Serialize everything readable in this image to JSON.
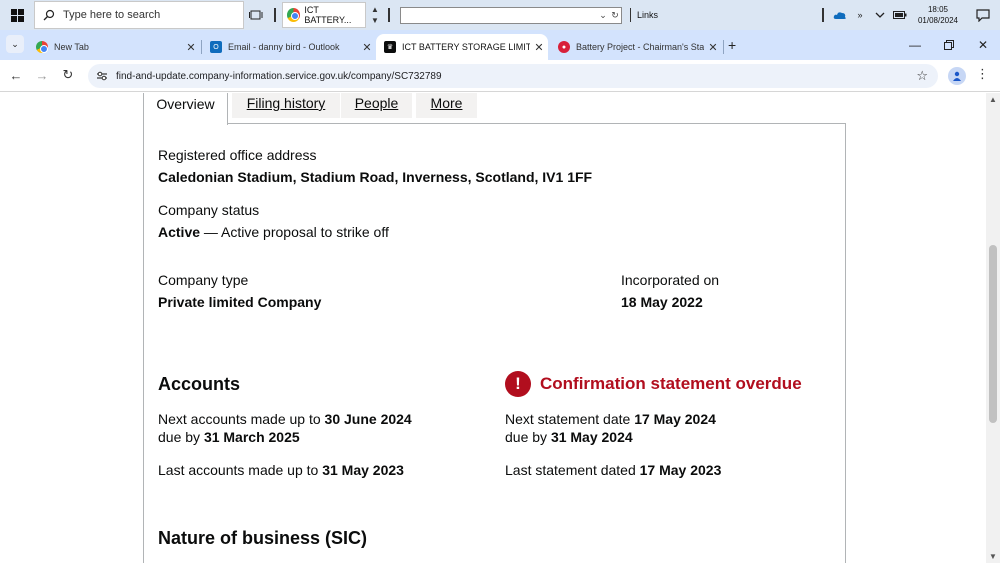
{
  "taskbar": {
    "search_placeholder": "Type here to search",
    "app_label": "ICT BATTERY...",
    "links_label": "Links",
    "clock_time": "18:05",
    "clock_date": "01/08/2024"
  },
  "browser": {
    "tabs": [
      {
        "label": "New Tab"
      },
      {
        "label": "Email - danny bird - Outlook"
      },
      {
        "label": "ICT BATTERY STORAGE LIMITED"
      },
      {
        "label": "Battery Project - Chairman's Sta"
      }
    ],
    "url": "find-and-update.company-information.service.gov.uk/company/SC732789"
  },
  "page": {
    "tabs": {
      "overview": "Overview",
      "filing_history": "Filing history",
      "people": "People",
      "more": "More"
    },
    "registered_office": {
      "label": "Registered office address",
      "value": "Caledonian Stadium, Stadium Road, Inverness, Scotland, IV1 1FF"
    },
    "company_status": {
      "label": "Company status",
      "value": "Active",
      "detail": " — Active proposal to strike off"
    },
    "company_type": {
      "label": "Company type",
      "value": "Private limited Company"
    },
    "incorporated": {
      "label": "Incorporated on",
      "value": "18 May 2022"
    },
    "accounts": {
      "heading": "Accounts",
      "next_prefix": "Next accounts made up to ",
      "next_date": "30 June 2024",
      "due_prefix": "due by ",
      "due_date": "31 March 2025",
      "last_prefix": "Last accounts made up to ",
      "last_date": "31 May 2023"
    },
    "confirmation": {
      "heading": "Confirmation statement overdue",
      "icon_text": "!",
      "next_prefix": "Next statement date ",
      "next_date": "17 May 2024",
      "due_prefix": "due by ",
      "due_date": "31 May 2024",
      "last_prefix": "Last statement dated ",
      "last_date": "17 May 2023"
    },
    "nature_heading": "Nature of business (SIC)"
  },
  "colors": {
    "warning": "#b10e1e",
    "text": "#0b0c0c",
    "tabstrip": "#d3e3fd",
    "taskbar": "#dbe6f3"
  }
}
